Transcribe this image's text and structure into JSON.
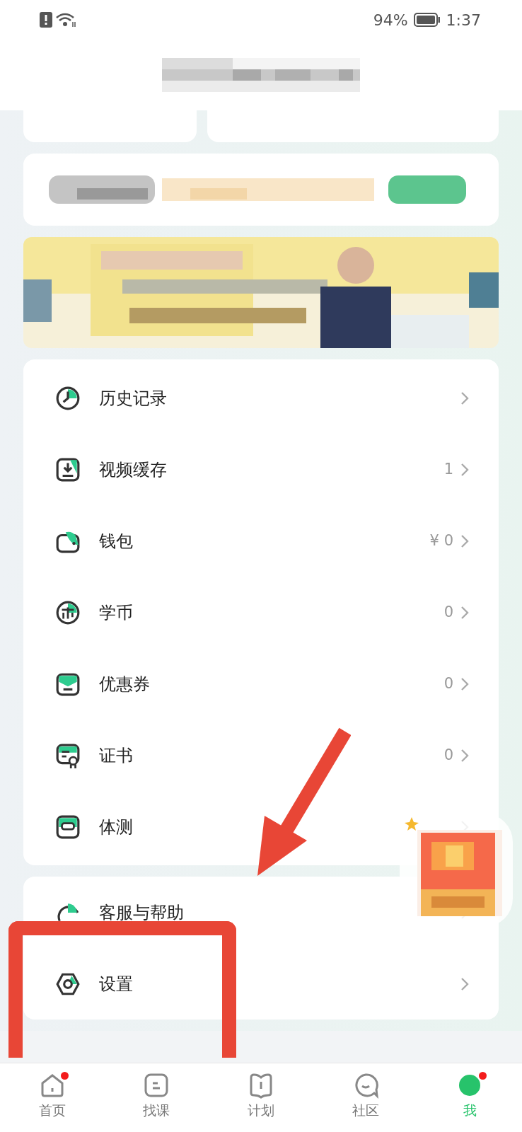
{
  "status_bar": {
    "battery": "94%",
    "time": "1:37"
  },
  "menu": [
    {
      "label": "历史记录"
    },
    {
      "label": "视频缓存",
      "value": "1"
    },
    {
      "label": "钱包",
      "value": "¥ 0"
    },
    {
      "label": "学币",
      "value": "0"
    },
    {
      "label": "优惠券",
      "value": "0"
    },
    {
      "label": "证书",
      "value": "0"
    },
    {
      "label": "体测"
    }
  ],
  "menu_2": [
    {
      "label": "客服与帮助"
    },
    {
      "label": "设置"
    }
  ],
  "tab_bar": [
    {
      "label": "首页",
      "selected": false,
      "dot": true
    },
    {
      "label": "找课",
      "selected": false,
      "dot": false
    },
    {
      "label": "计划",
      "selected": false,
      "dot": false
    },
    {
      "label": "社区",
      "selected": false,
      "dot": false
    },
    {
      "label": "我",
      "selected": true,
      "dot": true
    }
  ]
}
